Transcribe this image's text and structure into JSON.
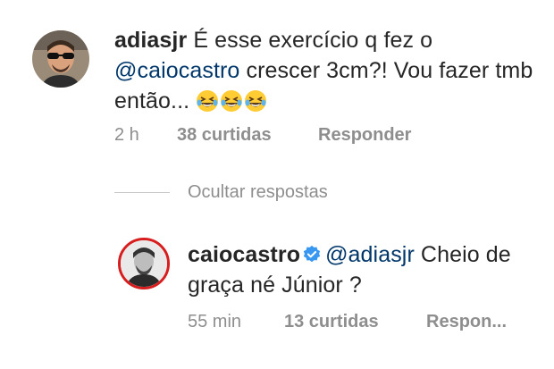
{
  "comment1": {
    "username": "adiasjr",
    "text_part1": " É esse exercício q fez o ",
    "mention": "@caiocastro",
    "text_part2": " crescer 3cm?! Vou fazer tmb então... ",
    "emojis": [
      "grinning-squinting-tears-icon",
      "grinning-squinting-tears-icon",
      "grinning-squinting-tears-icon"
    ],
    "time": "2 h",
    "likes": "38 curtidas",
    "reply": "Responder"
  },
  "hide_replies": "Ocultar respostas",
  "comment2": {
    "username": "caiocastro",
    "verified_icon": "verified-badge-icon",
    "mention": "@adiasjr",
    "text": " Cheio de graça né Júnior ?",
    "time": "55 min",
    "likes": "13 curtidas",
    "reply": "Respon..."
  },
  "colors": {
    "mention": "#00376b",
    "meta": "#8e8e8e",
    "verified": "#3897f0",
    "avatar_ring": "#d71d1d"
  }
}
